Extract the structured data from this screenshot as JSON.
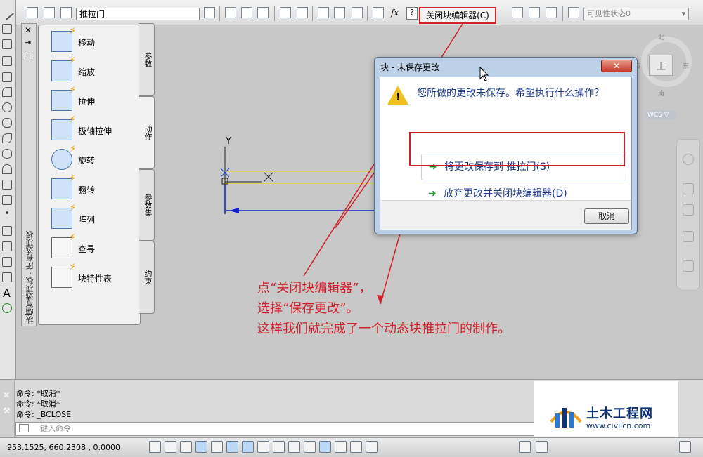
{
  "toolbar": {
    "block_name": "推拉门",
    "close_block_editor": "关闭块编辑器(C)",
    "fx_label": "fx",
    "help_label": "?",
    "visibility_state": "可见性状态0"
  },
  "palette": {
    "title": "块编写选项板 - 所有选项板",
    "items": [
      {
        "label": "移动",
        "icon": "move-action-icon"
      },
      {
        "label": "缩放",
        "icon": "scale-action-icon"
      },
      {
        "label": "拉伸",
        "icon": "stretch-action-icon"
      },
      {
        "label": "极轴拉伸",
        "icon": "polar-stretch-action-icon"
      },
      {
        "label": "旋转",
        "icon": "rotate-action-icon"
      },
      {
        "label": "翻转",
        "icon": "flip-action-icon"
      },
      {
        "label": "阵列",
        "icon": "array-action-icon"
      },
      {
        "label": "查寻",
        "icon": "lookup-action-icon"
      },
      {
        "label": "块特性表",
        "icon": "block-table-icon"
      }
    ],
    "tabs": [
      {
        "label": "参数",
        "active": false
      },
      {
        "label": "动作",
        "active": true
      },
      {
        "label": "参数集",
        "active": false
      },
      {
        "label": "约束",
        "active": false
      }
    ]
  },
  "canvas": {
    "ucs_y_label": "Y"
  },
  "dialog": {
    "title": "块 - 未保存更改",
    "close_glyph": "✕",
    "message": "您所做的更改未保存。希望执行什么操作？",
    "save_option": "将更改保存到 推拉门(S)",
    "discard_option": "放弃更改并关闭块编辑器(D)",
    "cancel_label": "取消"
  },
  "viewcube": {
    "north": "北",
    "south": "南",
    "east": "东",
    "west": "西",
    "face": "上",
    "wcs": "WCS ▽"
  },
  "annotation": {
    "line1": "点“关闭块编辑器”，",
    "line2": "选择“保存更改”。",
    "line3": "这样我们就完成了一个动态块推拉门的制作。",
    "color": "#d0202a"
  },
  "command": {
    "history": [
      "命令: *取消*",
      "命令: *取消*",
      "命令: _BCLOSE"
    ],
    "placeholder": "键入命令"
  },
  "watermark": {
    "title": "土木工程网",
    "url": "www.civilcn.com"
  },
  "status": {
    "coordinates": "953.1525,  660.2308 , 0.0000"
  },
  "colors": {
    "highlight_red": "#d0202a",
    "yellow_line": "#e8e000",
    "blue_line": "#1020d0"
  }
}
